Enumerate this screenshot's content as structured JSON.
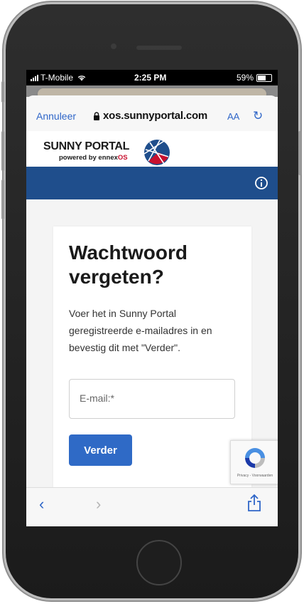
{
  "status_bar": {
    "carrier": "T-Mobile",
    "time": "2:25 PM",
    "battery": "59%",
    "battery_level": 0.59
  },
  "browser": {
    "cancel_label": "Annuleer",
    "url": "xos.sunnyportal.com",
    "text_size_label": "AA",
    "reload_icon": "reload-icon",
    "back_icon": "chevron-left-icon",
    "forward_icon": "chevron-right-icon",
    "share_icon": "share-icon"
  },
  "site": {
    "logo_title": "SUNNY PORTAL",
    "logo_sub_prefix": "powered by ennex",
    "logo_sub_suffix": "OS",
    "nav_color": "#1f4e8c",
    "info_icon": "info-icon"
  },
  "form": {
    "title": "Wachtwoord vergeten?",
    "description": "Voer het in Sunny Portal geregistreerde e-mailadres in en bevestig dit met \"Verder\".",
    "email_placeholder": "E-mail:*",
    "email_value": "",
    "submit_label": "Verder",
    "accent": "#2f6ac6"
  },
  "recaptcha": {
    "footer": "Privacy - Voorwaarden"
  }
}
